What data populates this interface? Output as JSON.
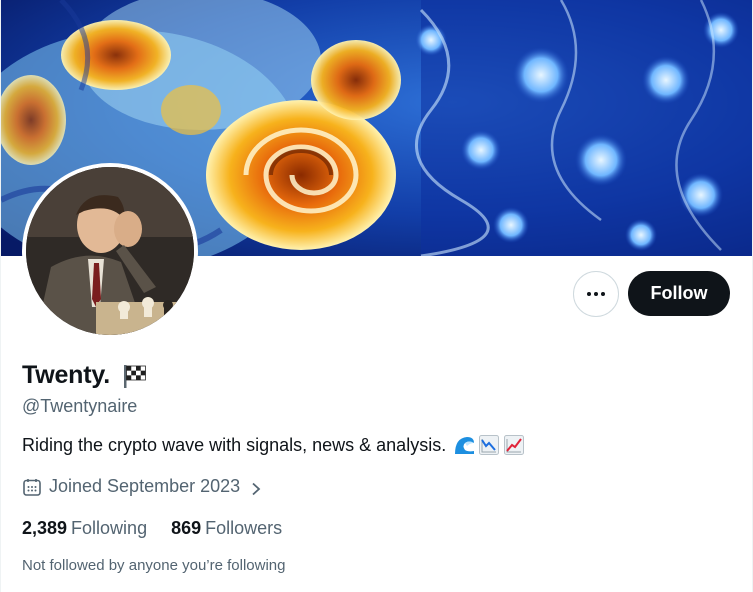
{
  "profile": {
    "display_name": "Twenty.",
    "handle": "@Twentynaire",
    "bio": "Riding the crypto wave with signals, news & analysis.",
    "joined": "Joined September 2023",
    "following_count": "2,389",
    "following_label": "Following",
    "followers_count": "869",
    "followers_label": "Followers",
    "not_followed_text": "Not followed by anyone you’re following"
  },
  "actions": {
    "follow_label": "Follow",
    "more_icon": "more-horizontal-icon"
  },
  "icons": {
    "name_badge": "checkered-flag-icon",
    "bio_emojis": [
      "wave-icon",
      "chart-decreasing-icon",
      "chart-increasing-icon"
    ],
    "joined": "calendar-icon",
    "joined_chevron": "chevron-right-icon"
  },
  "colors": {
    "primary_text": "#0f1419",
    "secondary_text": "#536471",
    "follow_button_bg": "#0f1419",
    "follow_button_text": "#ffffff",
    "border": "#cfd9de"
  }
}
